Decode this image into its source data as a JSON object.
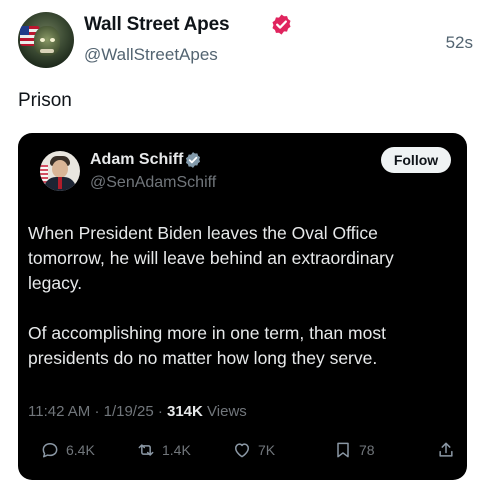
{
  "post": {
    "author_name": "Wall Street Apes",
    "author_handle": "@WallStreetApes",
    "time": "52s",
    "text": "Prison"
  },
  "quoted_post": {
    "author_name": "Adam Schiff",
    "author_handle": "@SenAdamSchiff",
    "follow_label": "Follow",
    "paragraph_1": "When President Biden leaves the Oval Office tomorrow, he will leave behind an extraordinary legacy.",
    "paragraph_2": "Of accomplishing more in one term, than most presidents do no matter how long they serve.",
    "time": "11:42 AM",
    "date": "1/19/25",
    "views_count": "314K",
    "views_label": "Views",
    "replies": "6.4K",
    "reposts": "1.4K",
    "likes": "7K",
    "bookmarks": "78"
  },
  "icons": {
    "verified_badge_main": "verified-badge-icon",
    "verified_badge_quoted": "verified-badge-icon",
    "reply": "reply-icon",
    "repost": "repost-icon",
    "like": "heart-icon",
    "bookmark": "bookmark-icon",
    "share": "share-icon"
  },
  "colors": {
    "verified_main": "#e0245e",
    "verified_quoted": "#829aab",
    "quote_background": "#000000",
    "secondary_text": "#536471"
  }
}
